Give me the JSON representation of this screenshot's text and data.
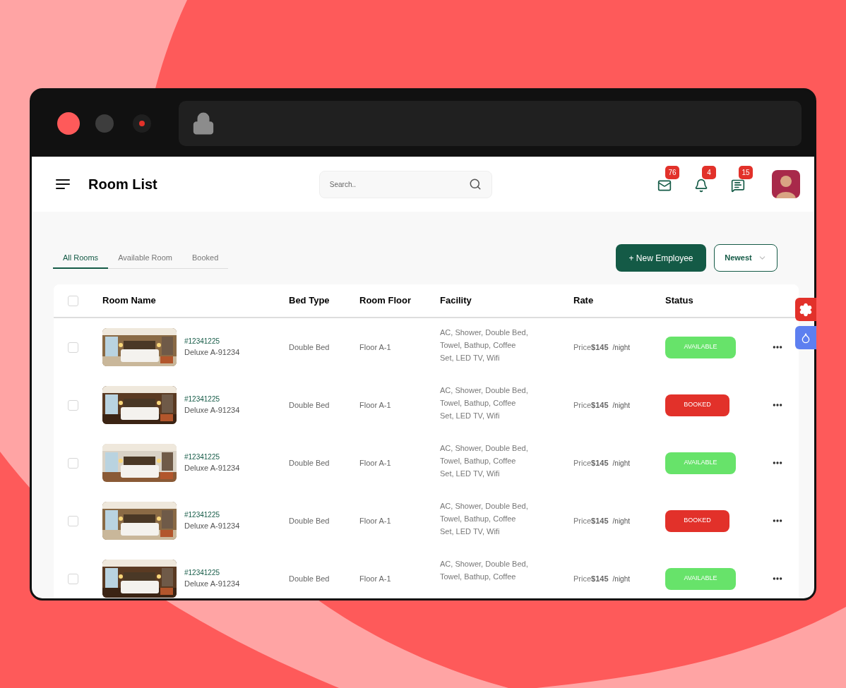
{
  "page": {
    "title": "Room List"
  },
  "search": {
    "placeholder": "Search.."
  },
  "notifications": [
    {
      "kind": "mail",
      "count": "76"
    },
    {
      "kind": "bell",
      "count": "4"
    },
    {
      "kind": "chat",
      "count": "15"
    }
  ],
  "tabs": [
    {
      "label": "All Rooms",
      "selected": true
    },
    {
      "label": "Available Room",
      "selected": false
    },
    {
      "label": "Booked",
      "selected": false
    }
  ],
  "new_button": "+ New Employee",
  "sort": {
    "value": "Newest"
  },
  "table": {
    "header_checked": false,
    "columns": [
      "Room Name",
      "Bed Type",
      "Room Floor",
      "Facility",
      "Rate",
      "Status"
    ],
    "rows": [
      {
        "checked": false,
        "id": "#12341225",
        "name": "Deluxe A-91234",
        "bed_type": "Double Bed",
        "floor": "Floor A-1",
        "facility": [
          "AC, Shower, Double Bed,",
          "Towel, Bathup, Coffee",
          "Set, LED TV, Wifi"
        ],
        "price_label": "Price",
        "price": "$145",
        "unit": "/night",
        "status": {
          "label": "AVAILABLE",
          "kind": "available"
        }
      },
      {
        "checked": false,
        "id": "#12341225",
        "name": "Deluxe A-91234",
        "bed_type": "Double Bed",
        "floor": "Floor A-1",
        "facility": [
          "AC, Shower, Double Bed,",
          "Towel, Bathup, Coffee",
          "Set, LED TV, Wifi"
        ],
        "price_label": "Price",
        "price": "$145",
        "unit": "/night",
        "status": {
          "label": "BOOKED",
          "kind": "booked"
        }
      },
      {
        "checked": false,
        "id": "#12341225",
        "name": "Deluxe A-91234",
        "bed_type": "Double Bed",
        "floor": "Floor A-1",
        "facility": [
          "AC, Shower, Double Bed,",
          "Towel, Bathup, Coffee",
          "Set, LED TV, Wifi"
        ],
        "price_label": "Price",
        "price": "$145",
        "unit": "/night",
        "status": {
          "label": "AVAILABLE",
          "kind": "available"
        }
      },
      {
        "checked": false,
        "id": "#12341225",
        "name": "Deluxe A-91234",
        "bed_type": "Double Bed",
        "floor": "Floor A-1",
        "facility": [
          "AC, Shower, Double Bed,",
          "Towel, Bathup, Coffee",
          "Set, LED TV, Wifi"
        ],
        "price_label": "Price",
        "price": "$145",
        "unit": "/night",
        "status": {
          "label": "BOOKED",
          "kind": "booked"
        }
      },
      {
        "checked": false,
        "id": "#12341225",
        "name": "Deluxe A-91234",
        "bed_type": "Double Bed",
        "floor": "Floor A-1",
        "facility": [
          "AC, Shower, Double Bed,",
          "Towel, Bathup, Coffee"
        ],
        "price_label": "Price",
        "price": "$145",
        "unit": "/night",
        "status": {
          "label": "AVAILABLE",
          "kind": "available"
        }
      }
    ]
  }
}
